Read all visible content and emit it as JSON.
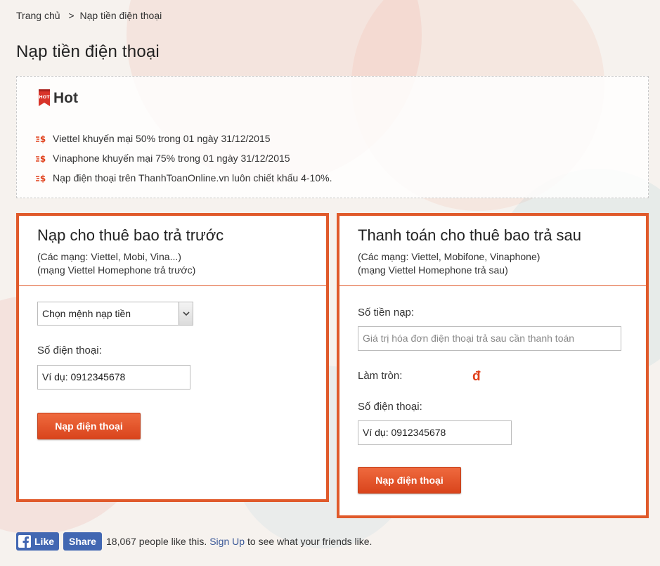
{
  "breadcrumb": {
    "home": "Trang chủ",
    "separator": ">",
    "current": "Nạp tiền điện thoại"
  },
  "page_title": "Nạp tiền điện thoại",
  "hot": {
    "icon_label": "HOT",
    "title": "Hot",
    "items": [
      "Viettel khuyến mại 50% trong 01 ngày 31/12/2015",
      "Vinaphone khuyến mại 75% trong 01 ngày 31/12/2015",
      "Nạp điện thoại trên ThanhToanOnline.vn luôn chiết khấu 4-10%."
    ]
  },
  "prepaid": {
    "title": "Nạp cho thuê bao trả trước",
    "sub1": "(Các mạng: Viettel, Mobi, Vina...)",
    "sub2": "(mạng Viettel Homephone trả trước)",
    "select_value": "Chọn mệnh nạp tiền",
    "phone_label": "Số điện thoại:",
    "phone_value": "Ví dụ: 0912345678",
    "button": "Nạp điện thoại"
  },
  "postpaid": {
    "title": "Thanh toán cho thuê bao trả sau",
    "sub1": "(Các mạng: Viettel, Mobifone, Vinaphone)",
    "sub2": "(mạng Viettel Homephone trả sau)",
    "amount_label": "Số tiền nạp:",
    "amount_placeholder": "Giá trị hóa đơn điện thoại trả sau cần thanh toán",
    "round_label": "Làm tròn:",
    "currency": "đ",
    "phone_label": "Số điện thoại:",
    "phone_value": "Ví dụ: 0912345678",
    "button": "Nạp điện thoại"
  },
  "facebook": {
    "like": "Like",
    "share": "Share",
    "count_text": "18,067 people like this.",
    "signup": "Sign Up",
    "suffix": "to see what your friends like."
  },
  "colors": {
    "accent": "#e05a2b",
    "button": "#d9441c",
    "facebook": "#4267b2"
  }
}
